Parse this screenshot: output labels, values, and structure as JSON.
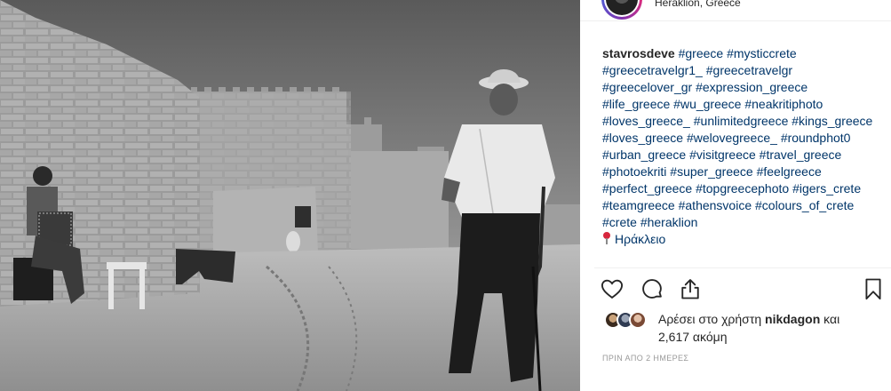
{
  "post": {
    "location": "Heraklion, Greece",
    "username": "stavrosdeve",
    "hashtags": [
      "#greece",
      "#mysticcrete",
      "#greecetravelgr1_",
      "#greecetravelgr",
      "#greecelover_gr",
      "#expression_greece",
      "#life_greece",
      "#wu_greece",
      "#neakritiphoto",
      "#loves_greece_",
      "#unlimitedgreece",
      "#kings_greece",
      "#loves_greece",
      "#welovegreece_",
      "#roundphot0",
      "#urban_greece",
      "#visitgreece",
      "#travel_greece",
      "#photoekriti",
      "#super_greece",
      "#feelgreece",
      "#perfect_greece",
      "#topgreecephoto",
      "#igers_crete",
      "#teamgreece",
      "#athensvoice",
      "#colours_of_crete",
      "#crete",
      "#heraklion"
    ],
    "place_tag": "Ηράκλειο",
    "likes_prefix": "Αρέσει στο χρήστη",
    "liker": "nikdagon",
    "likes_and": "και",
    "likes_count": "2,617 ακόμη",
    "timestamp": "ΠΡΙΝ ΑΠΟ 2 ΗΜΕΡΕΣ"
  },
  "icons": [
    "heart-icon",
    "comment-icon",
    "share-icon",
    "bookmark-icon",
    "location-pin-icon"
  ],
  "colors": {
    "hashtag": "#003569",
    "text": "#262626",
    "muted": "#999999"
  }
}
